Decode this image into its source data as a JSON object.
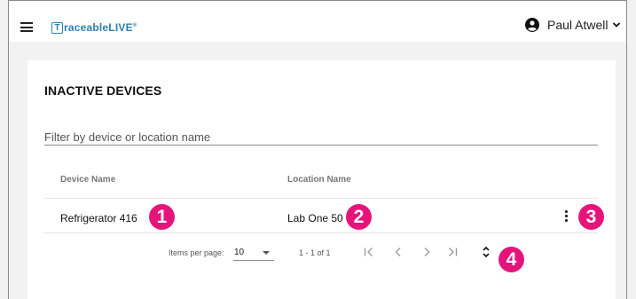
{
  "header": {
    "logo_mark": "T",
    "logo_text": "raceableLIVE",
    "logo_reg": "®",
    "user_name": "Paul Atwell"
  },
  "card": {
    "title": "INACTIVE DEVICES",
    "filter_placeholder": "Filter by device or location name"
  },
  "table": {
    "columns": [
      "Device Name",
      "Location Name"
    ],
    "rows": [
      {
        "device": "Refrigerator 416",
        "location": "Lab One 50"
      }
    ]
  },
  "pagination": {
    "items_per_page_label": "Items per page:",
    "items_per_page_value": "10",
    "range": "1 - 1 of 1"
  },
  "callouts": [
    "1",
    "2",
    "3",
    "4"
  ],
  "icons": [
    "menu-icon",
    "user-account-icon",
    "chevron-down-icon",
    "more-vert-icon",
    "first-page-icon",
    "chevron-left-icon",
    "chevron-right-icon",
    "last-page-icon",
    "unfold-icon"
  ],
  "colors": {
    "brand": "#2f7fb5",
    "callout": "#e5147a"
  }
}
